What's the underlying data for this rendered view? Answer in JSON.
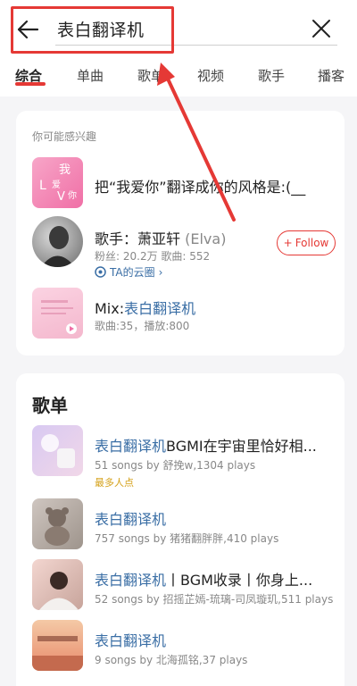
{
  "search": {
    "query": "表白翻译机"
  },
  "tabs": [
    {
      "label": "综合"
    },
    {
      "label": "单曲"
    },
    {
      "label": "歌单"
    },
    {
      "label": "视频"
    },
    {
      "label": "歌手"
    },
    {
      "label": "播客"
    }
  ],
  "interest": {
    "heading": "你可能感兴趣",
    "item1": {
      "title": "把“我爱你”翻译成你的风格是:(__"
    },
    "artist": {
      "prefix": "歌手：",
      "name": "萧亚轩",
      "alias": "(Elva)",
      "stats": "粉丝: 20.2万  歌曲: 552",
      "cloud_link": "TA的云圈",
      "follow_label": "Follow"
    },
    "mix": {
      "prefix": "Mix:",
      "name": "表白翻译机",
      "stats": "歌曲:35，播放:800"
    }
  },
  "playlists": {
    "heading": "歌单",
    "items": [
      {
        "title_accent": "表白翻译机",
        "title_rest": "BGMI在宇宙里恰好相...",
        "meta": "51 songs  by 舒挽w,1304 plays",
        "badge": "最多人点"
      },
      {
        "title_accent": "表白翻译机",
        "title_rest": "",
        "meta": "757 songs  by 猪猪翻胖胖,410 plays",
        "badge": ""
      },
      {
        "title_accent": "表白翻译机",
        "title_rest": "丨BGM收录丨你身上...",
        "meta": "52 songs  by 招摇芷嫣-琉璃-司凤璇玑,511 plays",
        "badge": ""
      },
      {
        "title_accent": "表白翻译机",
        "title_rest": "",
        "meta": "9 songs  by 北海孤铭,37 plays",
        "badge": ""
      }
    ]
  },
  "colors": {
    "accent_blue": "#3a6ea5",
    "brand_red": "#e53935",
    "badge_gold": "#d4a017"
  }
}
